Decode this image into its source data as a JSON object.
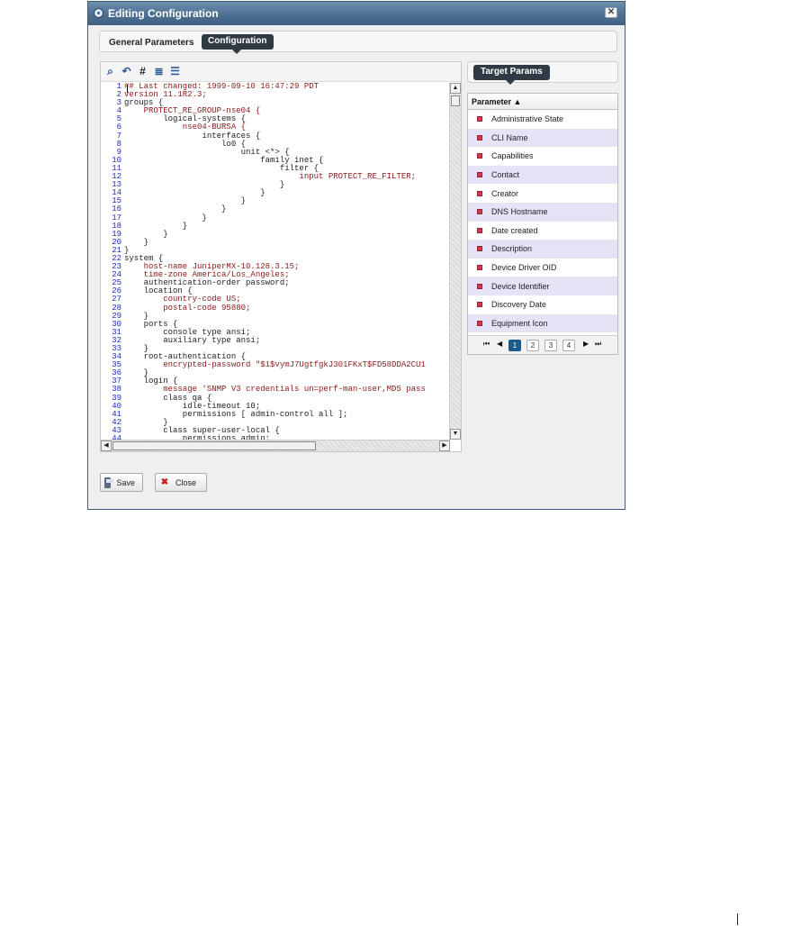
{
  "dialog": {
    "title": "Editing Configuration",
    "close_glyph": "✕"
  },
  "tabs": [
    {
      "label": "General Parameters"
    },
    {
      "label": "Configuration"
    }
  ],
  "toolbar": {
    "icons": [
      "search-icon",
      "undo-icon",
      "line-numbers-icon",
      "align-icon",
      "format-icon"
    ],
    "glyphs": [
      "⌕",
      "↶",
      "#",
      "≣",
      "☰"
    ]
  },
  "code_lines": [
    {
      "n": "1",
      "t": "## Last changed: 1999-09-10 16:47:29 PDT"
    },
    {
      "n": "2",
      "t": "version 11.1R2.3;"
    },
    {
      "n": "3",
      "t": "groups {"
    },
    {
      "n": "4",
      "t": "    PROTECT_RE_GROUP-nse04 {"
    },
    {
      "n": "5",
      "t": "        logical-systems {"
    },
    {
      "n": "6",
      "t": "            nse04-BURSA {"
    },
    {
      "n": "7",
      "t": "                interfaces {"
    },
    {
      "n": "8",
      "t": "                    lo0 {"
    },
    {
      "n": "9",
      "t": "                        unit <*> {"
    },
    {
      "n": "10",
      "t": "                            family inet {"
    },
    {
      "n": "11",
      "t": "                                filter {"
    },
    {
      "n": "12",
      "t": "                                    input PROTECT_RE_FILTER;"
    },
    {
      "n": "13",
      "t": "                                }"
    },
    {
      "n": "14",
      "t": "                            }"
    },
    {
      "n": "15",
      "t": "                        }"
    },
    {
      "n": "16",
      "t": "                    }"
    },
    {
      "n": "17",
      "t": "                }"
    },
    {
      "n": "18",
      "t": "            }"
    },
    {
      "n": "19",
      "t": "        }"
    },
    {
      "n": "20",
      "t": "    }"
    },
    {
      "n": "21",
      "t": "}"
    },
    {
      "n": "22",
      "t": "system {"
    },
    {
      "n": "23",
      "t": "    host-name JuniperMX-10.128.3.15;"
    },
    {
      "n": "24",
      "t": "    time-zone America/Los_Angeles;"
    },
    {
      "n": "25",
      "t": "    authentication-order password;"
    },
    {
      "n": "26",
      "t": "    location {"
    },
    {
      "n": "27",
      "t": "        country-code US;"
    },
    {
      "n": "28",
      "t": "        postal-code 95880;"
    },
    {
      "n": "29",
      "t": "    }"
    },
    {
      "n": "30",
      "t": "    ports {"
    },
    {
      "n": "31",
      "t": "        console type ansi;"
    },
    {
      "n": "32",
      "t": "        auxiliary type ansi;"
    },
    {
      "n": "33",
      "t": "    }"
    },
    {
      "n": "34",
      "t": "    root-authentication {"
    },
    {
      "n": "35",
      "t": "        encrypted-password \"$1$vymJ7UgtfgkJ301FKxT$FD58DDA2CU1"
    },
    {
      "n": "36",
      "t": "    }"
    },
    {
      "n": "37",
      "t": "    login {"
    },
    {
      "n": "38",
      "t": "        message 'SNMP V3 credentials un=perf-man-user,MD5 pass"
    },
    {
      "n": "39",
      "t": "        class qa {"
    },
    {
      "n": "40",
      "t": "            idle-timeout 10;"
    },
    {
      "n": "41",
      "t": "            permissions [ admin-control all ];"
    },
    {
      "n": "42",
      "t": "        }"
    },
    {
      "n": "43",
      "t": "        class super-user-local {"
    },
    {
      "n": "44",
      "t": "            permissions admin;"
    }
  ],
  "target_params": {
    "title": "Target Params",
    "column_header": "Parameter ▲",
    "rows": [
      "Administrative State",
      "CLI Name",
      "Capabilities",
      "Contact",
      "Creator",
      "DNS Hostname",
      "Date created",
      "Description",
      "Device Driver OID",
      "Device Identifier",
      "Discovery Date",
      "Equipment Icon"
    ],
    "pager": {
      "first": "⏮",
      "prev": "◀",
      "next": "▶",
      "last": "⏭",
      "pages": [
        "1",
        "2",
        "3",
        "4"
      ],
      "current": "1"
    }
  },
  "buttons": {
    "save": "Save",
    "close": "Close"
  },
  "colors": {
    "title_bar": "#4d6f91",
    "tab_active": "#303a44",
    "row_alt": "#e4e4f6",
    "param_marker": "#d8354d"
  }
}
